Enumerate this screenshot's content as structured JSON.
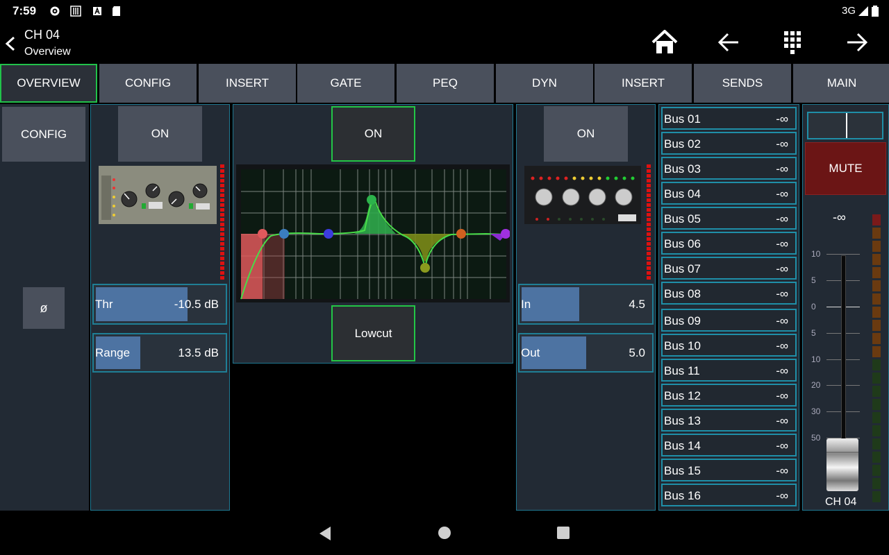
{
  "status": {
    "time": "7:59",
    "network": "3G"
  },
  "header": {
    "title": "CH 04",
    "subtitle": "Overview"
  },
  "tabs": [
    "OVERVIEW",
    "CONFIG",
    "INSERT",
    "GATE",
    "PEQ",
    "DYN",
    "INSERT",
    "SENDS",
    "MAIN"
  ],
  "config": {
    "config_label": "CONFIG",
    "phase_label": "ø"
  },
  "gate": {
    "on_label": "ON",
    "thr": {
      "label": "Thr",
      "value": "-10.5 dB",
      "fill": 0.72
    },
    "range": {
      "label": "Range",
      "value": "13.5 dB",
      "fill": 0.35
    }
  },
  "peq": {
    "on_label": "ON",
    "lowcut_label": "Lowcut"
  },
  "dyn": {
    "on_label": "ON",
    "in": {
      "label": "In",
      "value": "4.5",
      "fill": 0.45
    },
    "out": {
      "label": "Out",
      "value": "5.0",
      "fill": 0.5
    }
  },
  "sends": [
    {
      "name": "Bus 01",
      "level": "-∞"
    },
    {
      "name": "Bus 02",
      "level": "-∞"
    },
    {
      "name": "Bus 03",
      "level": "-∞"
    },
    {
      "name": "Bus 04",
      "level": "-∞"
    },
    {
      "name": "Bus 05",
      "level": "-∞"
    },
    {
      "name": "Bus 06",
      "level": "-∞"
    },
    {
      "name": "Bus 07",
      "level": "-∞"
    },
    {
      "name": "Bus 08",
      "level": "-∞"
    },
    {
      "name": "Bus 09",
      "level": "-∞"
    },
    {
      "name": "Bus 10",
      "level": "-∞"
    },
    {
      "name": "Bus 11",
      "level": "-∞"
    },
    {
      "name": "Bus 12",
      "level": "-∞"
    },
    {
      "name": "Bus 13",
      "level": "-∞"
    },
    {
      "name": "Bus 14",
      "level": "-∞"
    },
    {
      "name": "Bus 15",
      "level": "-∞"
    },
    {
      "name": "Bus 16",
      "level": "-∞"
    }
  ],
  "main": {
    "mute_label": "MUTE",
    "fader_value": "-∞",
    "scale": [
      "10",
      "5",
      "0",
      "5",
      "10",
      "20",
      "30",
      "50"
    ],
    "channel_label": "CH 04"
  },
  "colors": {
    "accent_green": "#21c24a",
    "panel_border": "#1f7891",
    "mute_red": "#6b1515",
    "fill_blue": "#4d73a2"
  }
}
